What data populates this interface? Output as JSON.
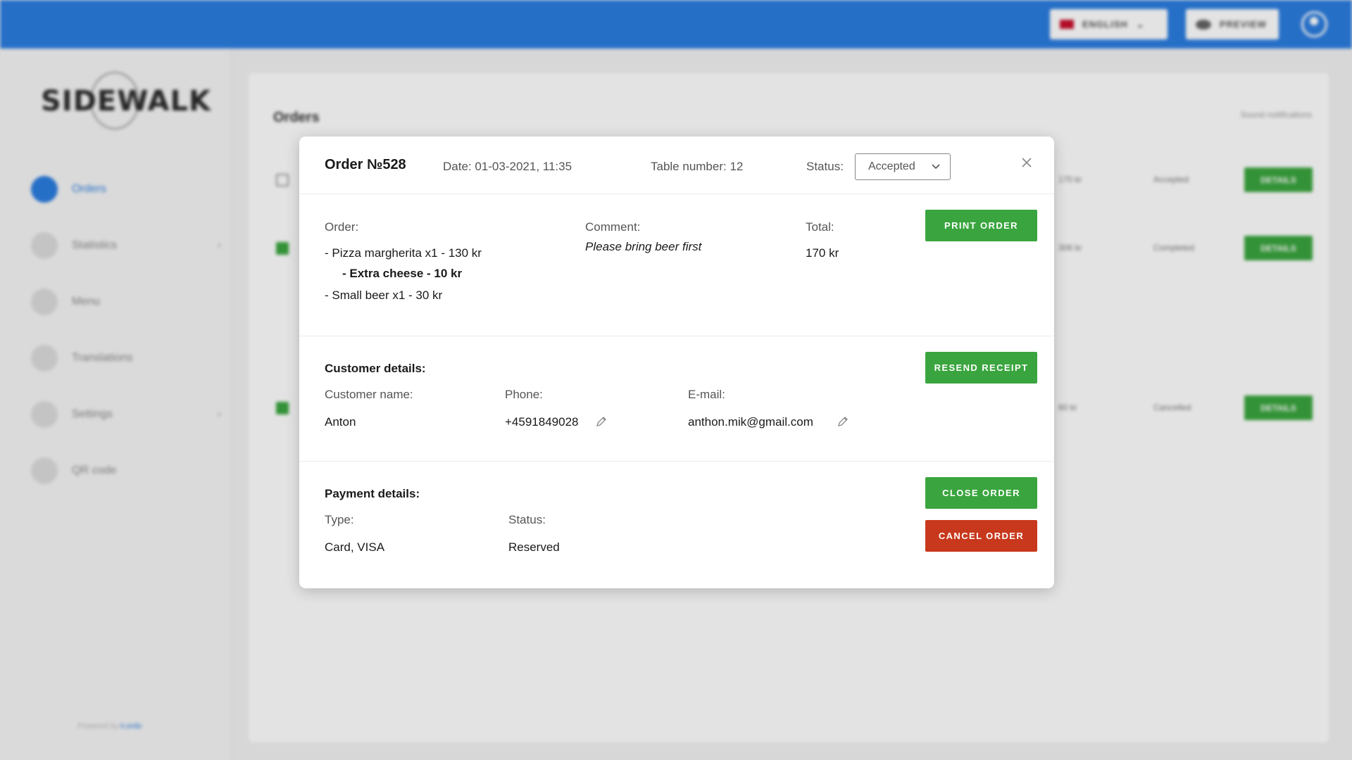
{
  "topbar": {
    "language_label": "ENGLISH",
    "preview_label": "PREVIEW"
  },
  "sidebar": {
    "logo_text": "SIDEWALK",
    "items": [
      {
        "label": "Orders",
        "active": true
      },
      {
        "label": "Statistics",
        "has_submenu": true
      },
      {
        "label": "Menu"
      },
      {
        "label": "Translations"
      },
      {
        "label": "Settings",
        "has_submenu": true
      },
      {
        "label": "QR code"
      }
    ],
    "powered_prefix": "Powered by",
    "powered_brand": "ii.ordo"
  },
  "orders_page": {
    "title": "Orders",
    "sound_label": "Sound notifications",
    "rows": [
      {
        "checked": false,
        "total": "170 kr",
        "status": "Accepted",
        "details_label": "DETAILS"
      },
      {
        "checked": true,
        "total": "306 kr",
        "status": "Completed",
        "details_label": "DETAILS"
      },
      {
        "checked": true,
        "total": "60 kr",
        "status": "Cancelled",
        "details_label": "DETAILS"
      }
    ]
  },
  "modal": {
    "title": "Order №528",
    "date": "Date: 01-03-2021, 11:35",
    "table_number": "Table number: 12",
    "status_label": "Status:",
    "status_value": "Accepted",
    "order": {
      "label": "Order:",
      "lines": [
        "- Pizza margherita x1 - 130 kr",
        "- Extra cheese - 10 kr",
        "- Small beer x1 - 30 kr"
      ],
      "comment_label": "Comment:",
      "comment": "Please bring beer first",
      "total_label": "Total:",
      "total": "170 kr",
      "print_button": "PRINT ORDER"
    },
    "customer": {
      "heading": "Customer details:",
      "name_label": "Customer name:",
      "name": "Anton",
      "phone_label": "Phone:",
      "phone": "+4591849028",
      "email_label": "E-mail:",
      "email": "anthon.mik@gmail.com",
      "resend_button": "RESEND RECEIPT"
    },
    "payment": {
      "heading": "Payment details:",
      "type_label": "Type:",
      "type": "Card, VISA",
      "status_label": "Status:",
      "status": "Reserved",
      "close_button": "CLOSE ORDER",
      "cancel_button": "CANCEL ORDER"
    }
  },
  "colors": {
    "primary": "#2b7de0",
    "success": "#3aa53e",
    "danger": "#c8381c"
  }
}
